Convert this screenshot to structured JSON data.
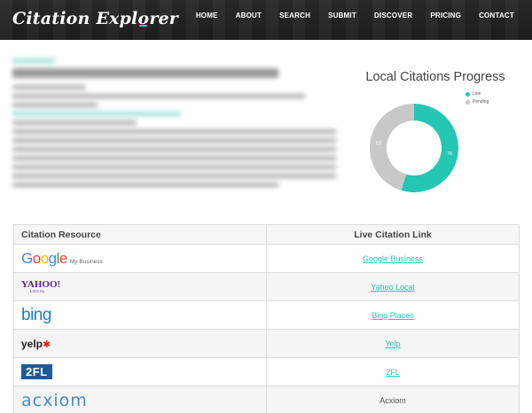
{
  "brand": {
    "pre": "Citation Expl",
    "accent": "o",
    "post": "rer"
  },
  "nav": [
    "HOME",
    "ABOUT",
    "SEARCH",
    "SUBMIT",
    "DISCOVER",
    "PRICING",
    "CONTACT"
  ],
  "chart_data": {
    "type": "pie",
    "title": "Local Citations Progress",
    "legend_position": "top-right",
    "series": [
      {
        "name": "Live",
        "value": 76,
        "color": "#26c6b5"
      },
      {
        "name": "Pending",
        "value": 63,
        "color": "#c8c8c8"
      }
    ]
  },
  "table": {
    "headers": [
      "Citation Resource",
      "Live Citation Link"
    ],
    "rows": [
      {
        "logo": "google",
        "logo_text": "Google",
        "logo_sub": "My Business",
        "link": "Google Business",
        "is_link": true
      },
      {
        "logo": "yahoo",
        "logo_text": "YAHOO!",
        "logo_sub": "LOCAL",
        "link": "Yahoo Local",
        "is_link": true
      },
      {
        "logo": "bing",
        "logo_text": "bing",
        "logo_sub": "",
        "link": "Bing Places",
        "is_link": true
      },
      {
        "logo": "yelp",
        "logo_text": "yelp",
        "logo_sub": "",
        "link": "Yelp",
        "is_link": true
      },
      {
        "logo": "2fl",
        "logo_text": "2FL",
        "logo_sub": "",
        "link": "2FL",
        "is_link": true
      },
      {
        "logo": "acxiom",
        "logo_text": "acxiom",
        "logo_sub": "",
        "link": "Acxiom",
        "is_link": false
      }
    ]
  },
  "colors": {
    "accent": "#26c6b5",
    "pending": "#c8c8c8",
    "header_bg": "#222222"
  }
}
